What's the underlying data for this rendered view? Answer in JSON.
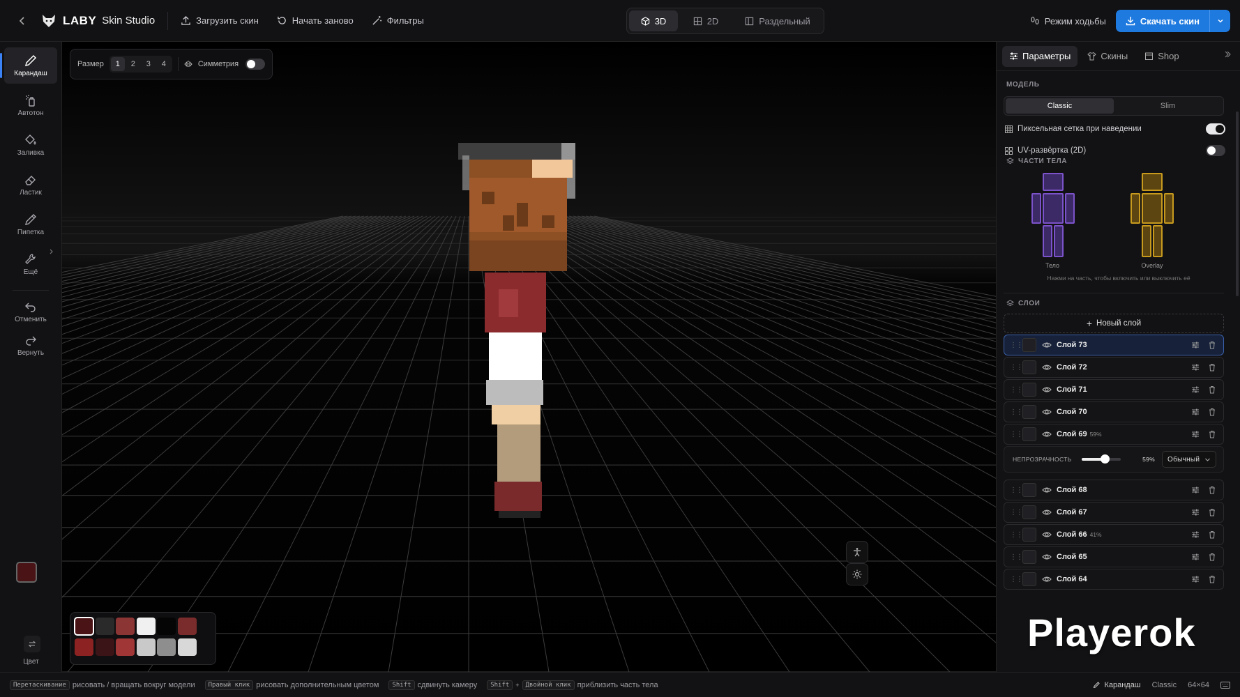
{
  "app": {
    "brand": "LABY",
    "product": "Skin Studio"
  },
  "topbar": {
    "upload_label": "Загрузить скин",
    "restart_label": "Начать заново",
    "filters_label": "Фильтры",
    "view_modes": [
      "3D",
      "2D",
      "Раздельный"
    ],
    "active_view": "3D",
    "walk_mode_label": "Режим ходьбы",
    "download_label": "Скачать скин"
  },
  "tools": [
    {
      "label": "Карандаш",
      "icon": "pencil-icon",
      "active": true
    },
    {
      "label": "Автотон",
      "icon": "spray-icon"
    },
    {
      "label": "Заливка",
      "icon": "bucket-icon"
    },
    {
      "label": "Ластик",
      "icon": "eraser-icon"
    },
    {
      "label": "Пипетка",
      "icon": "eyedropper-icon"
    },
    {
      "label": "Ещё",
      "icon": "wrench-icon"
    },
    {
      "label": "Отменить",
      "icon": "undo-icon"
    },
    {
      "label": "Вернуть",
      "icon": "redo-icon"
    }
  ],
  "color": {
    "label": "Цвет",
    "primary": "#4a1316",
    "secondary": "#0d0d0d"
  },
  "brush": {
    "size_label": "Размер",
    "sizes": [
      "1",
      "2",
      "3",
      "4"
    ],
    "active_size": "1",
    "symmetry_label": "Симметрия",
    "symmetry_on": false
  },
  "palette": [
    "#4a1316",
    "#2a2a2a",
    "#8c3535",
    "#f0f0f0",
    "#050505",
    "#7a2b2b",
    "#8d2222",
    "#3a1416",
    "#a03636",
    "#c9c9c9",
    "#8e8e8e",
    "#d8d8d8"
  ],
  "panel": {
    "tabs": [
      "Параметры",
      "Скины",
      "Shop"
    ],
    "active_tab": "Параметры",
    "model_section": "МОДЕЛЬ",
    "model_options": [
      "Classic",
      "Slim"
    ],
    "active_model": "Classic",
    "pixel_grid_label": "Пиксельная сетка при наведении",
    "pixel_grid_on": true,
    "uv_label": "UV-развёртка (2D)",
    "uv_on": false,
    "body_parts_section": "ЧАСТИ ТЕЛА",
    "body_label": "Тело",
    "overlay_label": "Overlay",
    "body_color": "#7b52c9",
    "overlay_color": "#c79a1e",
    "parts_hint": "Нажми на часть, чтобы включить или выключить её",
    "layers_section": "СЛОИ",
    "new_layer_label": "Новый слой",
    "layers": [
      {
        "name": "Слой 73",
        "selected": true
      },
      {
        "name": "Слой 72"
      },
      {
        "name": "Слой 71"
      },
      {
        "name": "Слой 70"
      },
      {
        "name": "Слой 69",
        "opacity": "59%"
      },
      {
        "name": "Слой 68"
      },
      {
        "name": "Слой 67"
      },
      {
        "name": "Слой 66",
        "opacity": "41%"
      },
      {
        "name": "Слой 65"
      },
      {
        "name": "Слой 64"
      }
    ],
    "opacity_label": "НЕПРОЗРАЧНОСТЬ",
    "opacity_value": "59%",
    "opacity_fraction": 0.59,
    "blend_mode": "Обычный"
  },
  "watermark": "Playerok",
  "statusbar": {
    "hints": [
      {
        "key": "Перетаскивание",
        "text": "рисовать / вращать вокруг модели"
      },
      {
        "key": "Правый клик",
        "text": "рисовать дополнительным цветом"
      },
      {
        "key": "Shift",
        "text": "сдвинуть камеру"
      },
      {
        "key": "Shift",
        "key2": "Двойной клик",
        "text": "приблизить часть тела"
      }
    ],
    "tool": "Карандаш",
    "model": "Classic",
    "resolution": "64×64"
  }
}
